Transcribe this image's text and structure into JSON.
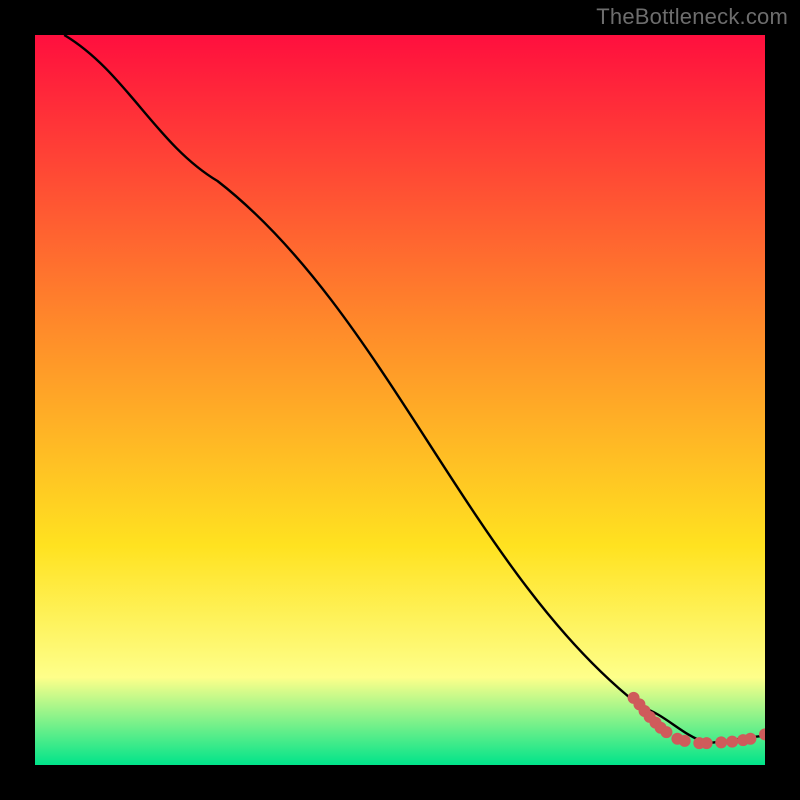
{
  "watermark_text": "TheBottleneck.com",
  "colors": {
    "frame": "#000000",
    "gradient_top": "#ff0f3e",
    "gradient_mid1": "#ff8a2a",
    "gradient_mid2": "#ffe220",
    "gradient_mid3": "#feff8a",
    "gradient_bottom": "#00e48a",
    "line": "#000000",
    "marker_fill": "#cf5b5b",
    "marker_stroke": "#cf5b5b"
  },
  "chart_data": {
    "type": "line",
    "title": "",
    "xlabel": "",
    "ylabel": "",
    "xlim": [
      0,
      100
    ],
    "ylim": [
      0,
      100
    ],
    "grid": false,
    "series": [
      {
        "name": "curve",
        "style": "line",
        "points": [
          {
            "x": 4,
            "y": 100
          },
          {
            "x": 25,
            "y": 80
          },
          {
            "x": 83,
            "y": 8
          },
          {
            "x": 92,
            "y": 3
          },
          {
            "x": 100,
            "y": 4
          }
        ]
      },
      {
        "name": "markers",
        "style": "scatter",
        "points": [
          {
            "x": 82,
            "y": 9.2
          },
          {
            "x": 82.8,
            "y": 8.3
          },
          {
            "x": 83.5,
            "y": 7.4
          },
          {
            "x": 84.2,
            "y": 6.6
          },
          {
            "x": 85.0,
            "y": 5.8
          },
          {
            "x": 85.7,
            "y": 5.1
          },
          {
            "x": 86.5,
            "y": 4.5
          },
          {
            "x": 88.0,
            "y": 3.6
          },
          {
            "x": 89.0,
            "y": 3.3
          },
          {
            "x": 91.0,
            "y": 3.0
          },
          {
            "x": 92.0,
            "y": 3.0
          },
          {
            "x": 94.0,
            "y": 3.1
          },
          {
            "x": 95.5,
            "y": 3.2
          },
          {
            "x": 97.0,
            "y": 3.4
          },
          {
            "x": 98.0,
            "y": 3.6
          },
          {
            "x": 100.0,
            "y": 4.2
          }
        ]
      }
    ]
  }
}
